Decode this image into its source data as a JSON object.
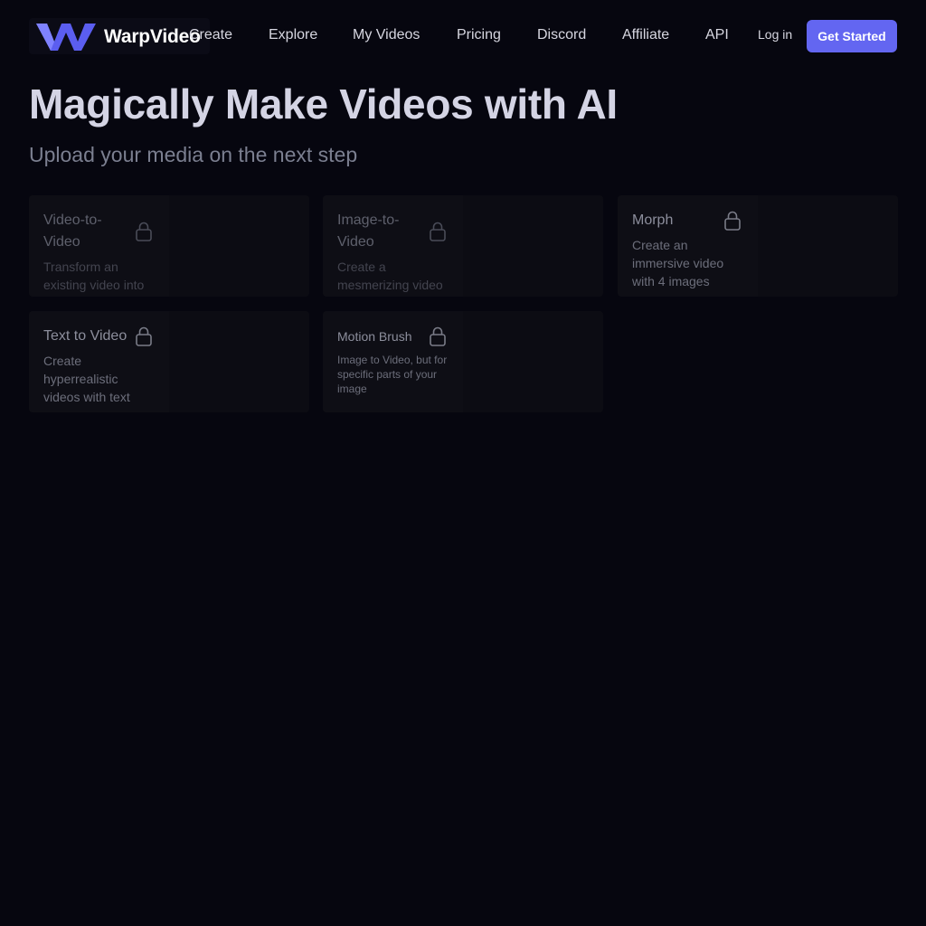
{
  "brand": {
    "name": "WarpVideo",
    "accent": "#6366f1"
  },
  "nav": {
    "links": [
      "Create",
      "Explore",
      "My Videos",
      "Pricing",
      "Discord",
      "Affiliate",
      "API"
    ],
    "login": "Log in",
    "cta": "Get Started"
  },
  "hero": {
    "title": "Magically Make Videos with AI",
    "subtitle": "Upload your media on the next step"
  },
  "cards": [
    {
      "title": "Video-to-Video",
      "desc": "Transform an existing video into",
      "icon": "lock-icon"
    },
    {
      "title": "Image-to-Video",
      "desc": "Create a mesmerizing video",
      "icon": "lock-icon"
    },
    {
      "title": "Morph",
      "desc": "Create an immersive video with 4 images",
      "icon": "lock-icon"
    },
    {
      "title": "Text to Video",
      "desc": "Create hyperrealistic videos with text",
      "icon": "lock-icon"
    },
    {
      "title": "Motion Brush",
      "desc": "Image to Video, but for specific parts of your image",
      "icon": "lock-icon"
    }
  ]
}
